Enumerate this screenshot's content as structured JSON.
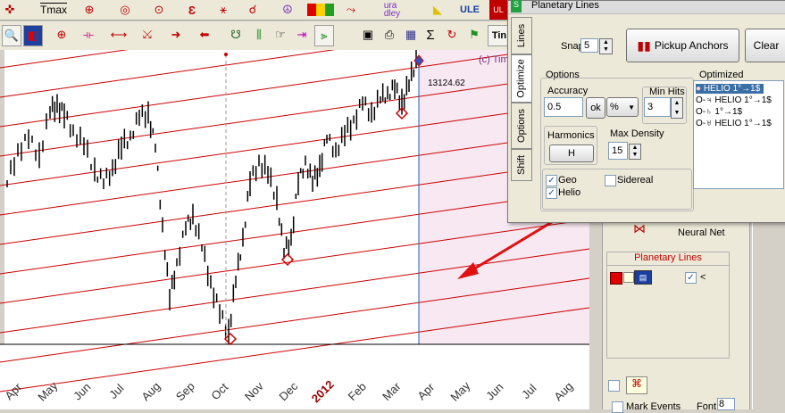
{
  "toolbar_top": {
    "tmax_label": "Tmax",
    "uradley_label": "ura\ndley",
    "ule_label": "ULE"
  },
  "toolbar_second": {
    "sum_label": "Σ",
    "tin_label": "Tin"
  },
  "chart": {
    "copyright": "(c) Tim",
    "last_price": "13124.62",
    "months": [
      "Apr",
      "May",
      "Jun",
      "Jul",
      "Aug",
      "Sep",
      "Oct",
      "Nov",
      "Dec",
      "2012",
      "Feb",
      "Mar",
      "Apr",
      "May",
      "Jun",
      "Jul",
      "Aug"
    ],
    "year_label_color": "#990000"
  },
  "dialog": {
    "title": "Planetary Lines",
    "tabs": [
      "Lines",
      "Optimize",
      "Options",
      "Shift"
    ],
    "snap_label": "Snap",
    "snap_value": "5",
    "pickup_button": "Pickup Anchors",
    "clear_button": "Clear",
    "options_group": "Options",
    "accuracy_label": "Accuracy",
    "accuracy_value": "0.5",
    "ok_button": "ok",
    "percent_value": "%",
    "min_hits_label": "Min Hits",
    "min_hits_value": "3",
    "harmonics_label": "Harmonics",
    "harmonics_button": "H",
    "max_density_label": "Max Density",
    "max_density_value": "15",
    "geo_label": "Geo",
    "helio_label": "Helio",
    "sidereal_label": "Sidereal",
    "optimized_label": "Optimized",
    "optimized_items": [
      "HELIO 1°→1$",
      "O-♃ HELIO 1°→1$",
      "O-♄ 1°→1$",
      "O-♅ HELIO 1°→1$"
    ]
  },
  "sidebar": {
    "neural_net": "Neural Net",
    "planetary_lines": "Planetary Lines",
    "mark_events": "Mark Events",
    "font_label": "Font",
    "font_value": "8"
  },
  "colors": {
    "line_red": "#cc0000",
    "arrow_red": "#e01010",
    "forecast_bg": "#f7e8f1",
    "cursor_blue": "#2060c0"
  }
}
